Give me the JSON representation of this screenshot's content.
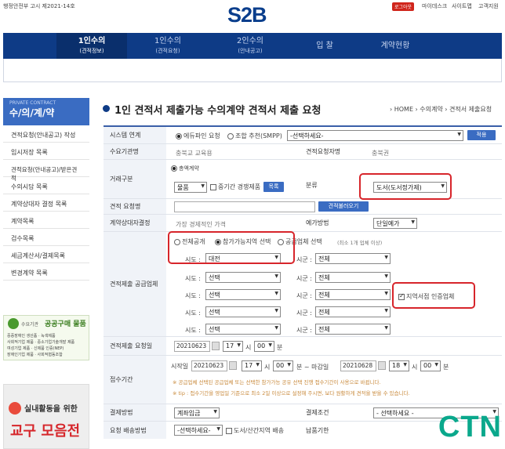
{
  "header": {
    "notice": "행정안전부 고시 제2021-14호",
    "logo": "S2B",
    "login": "로그아웃",
    "mydesk": "마이데스크",
    "sitemap": "사이트맵",
    "service": "고객지원"
  },
  "nav": [
    {
      "label": "1인수의",
      "sub": "(견적정보)"
    },
    {
      "label": "1인수의",
      "sub": "(견적요청)"
    },
    {
      "label": "2인수의",
      "sub": "(안내공고)"
    },
    {
      "label": "입 찰",
      "sub": ""
    },
    {
      "label": "계약현황",
      "sub": ""
    }
  ],
  "sidebar": {
    "en": "PRIVATE CONTRACT",
    "ko": "수/의/계/약",
    "items": [
      "견적요청(안내공고) 작성",
      "임시저장 목록",
      "견적요청(안내공고)/받은견적",
      "수의시담 목록",
      "계약상대자 결정 목록",
      "계약목록",
      "검수목록",
      "세금계산서/결제목록",
      "변경계약 목록"
    ]
  },
  "banner1": {
    "small": "수요기관",
    "big": "공공구매 물품",
    "lines": [
      "중증장애인 생산품 · 녹색제품",
      "사회적기업 제품 · 중소기업기술개발 제품",
      "여성기업 제품 · 신제품 인증(NEP)",
      "장애인기업 제품 · 사회적협동조합"
    ]
  },
  "banner2": {
    "line1": "실내활동을 위한",
    "line2": "교구 모음전"
  },
  "page": {
    "title": "1인 견적서 제출가능 수의계약 견적서 제출 요청",
    "crumb": "› HOME › 수의계약 › 견적서 제출요청"
  },
  "form": {
    "system": {
      "label": "시스템 연계",
      "opt1": "에듀파인 요청",
      "opt2": "조합 추천(SMPP)",
      "select": "-선택하세요-",
      "btn": "적용"
    },
    "org": {
      "label": "수요기관명",
      "value": "충북교 교육용",
      "label2": "견적요청자명",
      "value2": "충북권"
    },
    "trade": {
      "label": "거래구분",
      "chk": "총액계약",
      "select": "물품",
      "chk2": "중기간 경쟁제품",
      "btn": "목록",
      "label2": "분류",
      "select2": "도서(도서정가제)"
    },
    "quote": {
      "label": "견적 요청명",
      "btn": "견적불러오기"
    },
    "contract": {
      "label": "계약상대자결정",
      "value": "가장 경제적인 가격",
      "label2": "예가방법",
      "select": "단일예가"
    },
    "region": {
      "label": "견적제출 공급업체",
      "opt1": "전체공개",
      "opt2": "참가가능지역 선택",
      "opt3": "공급업체 선택",
      "opt3_note": "(최소 1개 업체 이상)",
      "sido_label": "시도 :",
      "sigun_label": "시군 :",
      "rows": [
        {
          "sido": "대전",
          "sigun": "전체"
        },
        {
          "sido": "선택",
          "sigun": "전체"
        },
        {
          "sido": "선택",
          "sigun": "전체"
        },
        {
          "sido": "선택",
          "sigun": "전체"
        },
        {
          "sido": "선택",
          "sigun": "전체"
        }
      ],
      "cert": "지역서점 인증업체"
    },
    "date": {
      "label": "견적제출 요청일",
      "date": "20210623",
      "hour": "17",
      "h": "시",
      "min": "00",
      "m": "분"
    },
    "period": {
      "label": "접수기간",
      "start": "시작일",
      "startDate": "20210623",
      "startHour": "17",
      "startMin": "00",
      "tilde": "분 ~ 마감일",
      "endDate": "20210628",
      "endHour": "18",
      "endMin": "00",
      "h": "시",
      "m": "분",
      "note1": "※ 공급업체 선택된 공급업체 또는 선택한 참가가능 공유 선택 진행 접수기간이 사용으로 바뀝니다.",
      "note2": "※ tip : 접수기간을 영업일 기준으로 최소 2일 이상으로 설정해 주시면, 보다 원활하게 견적을 받을 수 있습니다."
    },
    "payment": {
      "label": "결제방법",
      "select": "계좌입금",
      "label2": "결제조건",
      "select2": "- 선택하세요 -"
    },
    "delivery": {
      "label": "요청 배송방법",
      "select": "-선택하세요-",
      "chk": "도서/산간지역 배송",
      "label2": "납품기한"
    }
  },
  "watermark": "CTN"
}
